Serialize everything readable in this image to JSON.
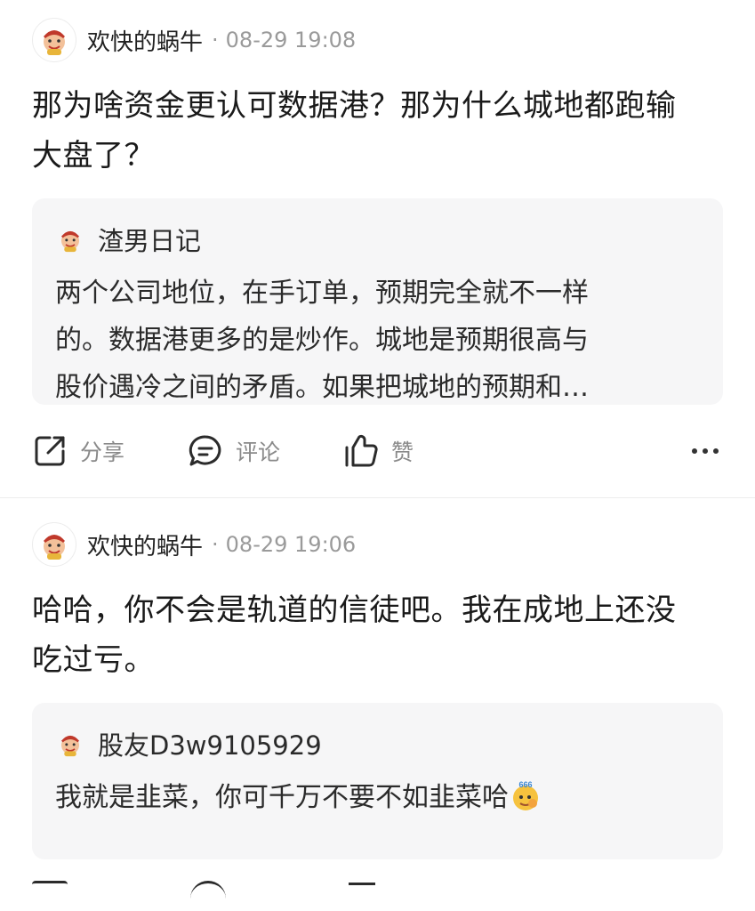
{
  "posts": [
    {
      "username": "欢快的蜗牛",
      "time": "08-29 19:08",
      "text_lines": [
        "那为啥资金更认可数据港？那为什么城地都跑输",
        "大盘了？"
      ],
      "quote": {
        "name": "渣男日记",
        "lines": [
          "两个公司地位，在手订单，预期完全就不一样",
          "的。数据港更多的是炒作。城地是预期很高与",
          "股价遇冷之间的矛盾。如果把城地的预期和…"
        ]
      },
      "actions": {
        "share": "分享",
        "comment": "评论",
        "like": "赞"
      }
    },
    {
      "username": "欢快的蜗牛",
      "time": "08-29 19:06",
      "text_lines": [
        "哈哈，你不会是轨道的信徒吧。我在成地上还没",
        "吃过亏。"
      ],
      "quote": {
        "name": "股友D3w9105929",
        "lines": [
          "我就是韭菜，你可千万不要不如韭菜哈"
        ],
        "emoji": "666-emoji"
      }
    }
  ],
  "icons": [
    "share-icon",
    "comment-icon",
    "like-icon",
    "more-icon",
    "avatar-icon"
  ],
  "colors": {
    "muted": "#8a8a8a",
    "card": "#f6f6f7",
    "divider": "#ececec"
  }
}
